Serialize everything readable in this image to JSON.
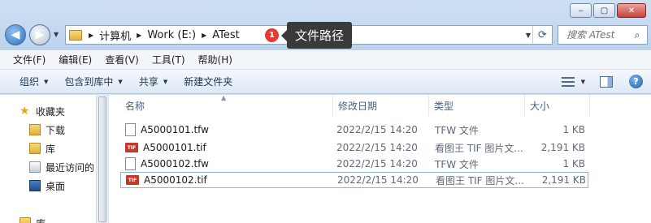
{
  "window": {
    "minimize": "‒",
    "maximize": "▢",
    "close": "✕"
  },
  "address": {
    "crumbs": [
      "计算机",
      "Work (E:)",
      "ATest"
    ]
  },
  "search": {
    "placeholder": "搜索 ATest"
  },
  "callout": {
    "badge": "1",
    "text": "文件路径"
  },
  "menu": [
    "文件(F)",
    "编辑(E)",
    "查看(V)",
    "工具(T)",
    "帮助(H)"
  ],
  "toolbar": {
    "organize": "组织",
    "include": "包含到库中",
    "share": "共享",
    "new_folder": "新建文件夹"
  },
  "navpane": {
    "favorites": "收藏夹",
    "downloads": "下载",
    "library": "库",
    "recent": "最近访问的",
    "desktop": "桌面",
    "library2": "库"
  },
  "columns": {
    "name": "名称",
    "date": "修改日期",
    "type": "类型",
    "size": "大小"
  },
  "files": [
    {
      "name": "A5000101.tfw",
      "date": "2022/2/15 14:20",
      "type": "TFW 文件",
      "size": "1 KB",
      "kind": "doc"
    },
    {
      "name": "A5000101.tif",
      "date": "2022/2/15 14:20",
      "type": "看图王 TIF 图片文...",
      "size": "2,191 KB",
      "kind": "tif"
    },
    {
      "name": "A5000102.tfw",
      "date": "2022/2/15 14:20",
      "type": "TFW 文件",
      "size": "1 KB",
      "kind": "doc"
    },
    {
      "name": "A5000102.tif",
      "date": "2022/2/15 14:20",
      "type": "看图王 TIF 图片文...",
      "size": "2,191 KB",
      "kind": "tif"
    }
  ],
  "colors": {
    "accent": "#3399ff",
    "badge": "#e53935",
    "callout_bg": "#3a3a3a"
  },
  "icons": [
    "back-icon",
    "forward-icon",
    "folder-icon",
    "refresh-icon",
    "search-icon",
    "view-icon",
    "preview-pane-icon",
    "help-icon",
    "star-icon",
    "tif-icon",
    "document-icon"
  ]
}
